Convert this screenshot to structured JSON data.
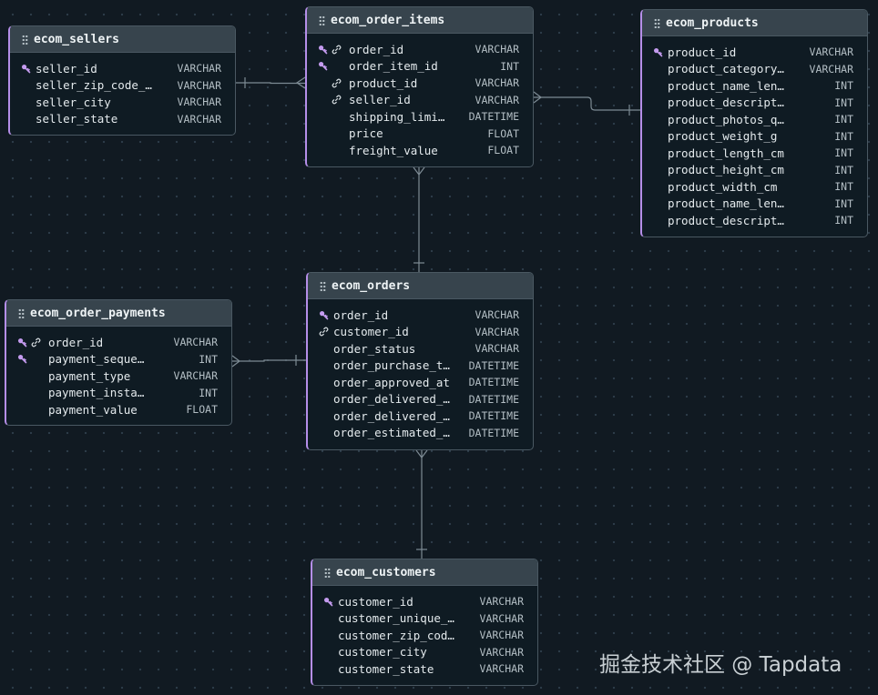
{
  "watermark": "掘金技术社区 @ Tapdata",
  "tables": {
    "ecom_sellers": {
      "name": "ecom_sellers",
      "columns": [
        {
          "name": "seller_id",
          "type": "VARCHAR",
          "icons": [
            "key"
          ]
        },
        {
          "name": "seller_zip_code_…",
          "type": "VARCHAR",
          "icons": []
        },
        {
          "name": "seller_city",
          "type": "VARCHAR",
          "icons": []
        },
        {
          "name": "seller_state",
          "type": "VARCHAR",
          "icons": []
        }
      ]
    },
    "ecom_order_items": {
      "name": "ecom_order_items",
      "columns": [
        {
          "name": "order_id",
          "type": "VARCHAR",
          "icons": [
            "key",
            "link"
          ]
        },
        {
          "name": "order_item_id",
          "type": "INT",
          "icons": [
            "key"
          ]
        },
        {
          "name": "product_id",
          "type": "VARCHAR",
          "icons": [
            "",
            "link"
          ]
        },
        {
          "name": "seller_id",
          "type": "VARCHAR",
          "icons": [
            "",
            "link"
          ]
        },
        {
          "name": "shipping_limi…",
          "type": "DATETIME",
          "icons": []
        },
        {
          "name": "price",
          "type": "FLOAT",
          "icons": []
        },
        {
          "name": "freight_value",
          "type": "FLOAT",
          "icons": []
        }
      ]
    },
    "ecom_products": {
      "name": "ecom_products",
      "columns": [
        {
          "name": "product_id",
          "type": "VARCHAR",
          "icons": [
            "key"
          ]
        },
        {
          "name": "product_category…",
          "type": "VARCHAR",
          "icons": []
        },
        {
          "name": "product_name_len…",
          "type": "INT",
          "icons": []
        },
        {
          "name": "product_descript…",
          "type": "INT",
          "icons": []
        },
        {
          "name": "product_photos_q…",
          "type": "INT",
          "icons": []
        },
        {
          "name": "product_weight_g",
          "type": "INT",
          "icons": []
        },
        {
          "name": "product_length_cm",
          "type": "INT",
          "icons": []
        },
        {
          "name": "product_height_cm",
          "type": "INT",
          "icons": []
        },
        {
          "name": "product_width_cm",
          "type": "INT",
          "icons": []
        },
        {
          "name": "product_name_len…",
          "type": "INT",
          "icons": []
        },
        {
          "name": "product_descript…",
          "type": "INT",
          "icons": []
        }
      ]
    },
    "ecom_orders": {
      "name": "ecom_orders",
      "columns": [
        {
          "name": "order_id",
          "type": "VARCHAR",
          "icons": [
            "key"
          ]
        },
        {
          "name": "customer_id",
          "type": "VARCHAR",
          "icons": [
            "link"
          ]
        },
        {
          "name": "order_status",
          "type": "VARCHAR",
          "icons": []
        },
        {
          "name": "order_purchase_t…",
          "type": "DATETIME",
          "icons": []
        },
        {
          "name": "order_approved_at",
          "type": "DATETIME",
          "icons": []
        },
        {
          "name": "order_delivered_…",
          "type": "DATETIME",
          "icons": []
        },
        {
          "name": "order_delivered_…",
          "type": "DATETIME",
          "icons": []
        },
        {
          "name": "order_estimated_…",
          "type": "DATETIME",
          "icons": []
        }
      ]
    },
    "ecom_order_payments": {
      "name": "ecom_order_payments",
      "columns": [
        {
          "name": "order_id",
          "type": "VARCHAR",
          "icons": [
            "key",
            "link"
          ]
        },
        {
          "name": "payment_seque…",
          "type": "INT",
          "icons": [
            "key"
          ]
        },
        {
          "name": "payment_type",
          "type": "VARCHAR",
          "icons": []
        },
        {
          "name": "payment_insta…",
          "type": "INT",
          "icons": []
        },
        {
          "name": "payment_value",
          "type": "FLOAT",
          "icons": []
        }
      ]
    },
    "ecom_customers": {
      "name": "ecom_customers",
      "columns": [
        {
          "name": "customer_id",
          "type": "VARCHAR",
          "icons": [
            "key"
          ]
        },
        {
          "name": "customer_unique_…",
          "type": "VARCHAR",
          "icons": []
        },
        {
          "name": "customer_zip_cod…",
          "type": "VARCHAR",
          "icons": []
        },
        {
          "name": "customer_city",
          "type": "VARCHAR",
          "icons": []
        },
        {
          "name": "customer_state",
          "type": "VARCHAR",
          "icons": []
        }
      ]
    }
  },
  "colors": {
    "background": "#111a22",
    "table_accent": "#b58ee8",
    "header": "#37444d",
    "connector": "#7d8b94"
  }
}
